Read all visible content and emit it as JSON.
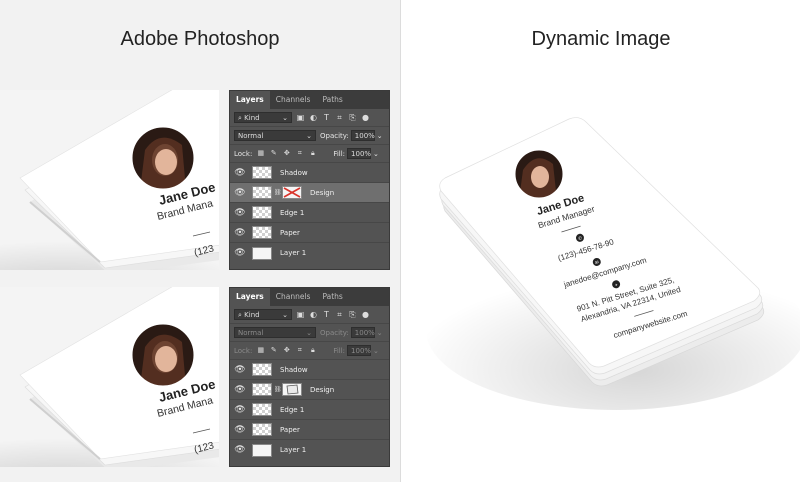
{
  "headings": {
    "left": "Adobe Photoshop",
    "right": "Dynamic Image"
  },
  "card": {
    "name": "Jane Doe",
    "title": "Brand Manager",
    "title_cropped": "Brand Mana",
    "phone": "(123)-456-78-90",
    "phone_cropped": "(123",
    "email": "janedoe@company.com",
    "address_line1": "901 N. Pitt Street, Suite 325,",
    "address_line2": "Alexandria, VA 22314, United",
    "website": "companywebsite.com"
  },
  "layers_panel": {
    "tabs": [
      "Layers",
      "Channels",
      "Paths"
    ],
    "filter_kind": "Kind",
    "blend_mode": "Normal",
    "opacity_label": "Opacity:",
    "opacity_value": "100%",
    "lock_label": "Lock:",
    "fill_label": "Fill:",
    "fill_value": "100%",
    "layers": [
      {
        "name": "Shadow"
      },
      {
        "name": "Design"
      },
      {
        "name": "Edge 1"
      },
      {
        "name": "Paper"
      },
      {
        "name": "Layer 1"
      }
    ]
  },
  "icons": {
    "visibility": "eye-icon",
    "filter": "search-icon",
    "link": "chain-link-icon",
    "phone": "phone-icon",
    "email": "email-icon",
    "location": "location-pin-icon"
  },
  "colors": {
    "panel_bg": "#535353",
    "panel_tab_bg": "#3c3c3c",
    "selected_layer": "#6f6f6f",
    "mask_x": "#d9342b"
  }
}
